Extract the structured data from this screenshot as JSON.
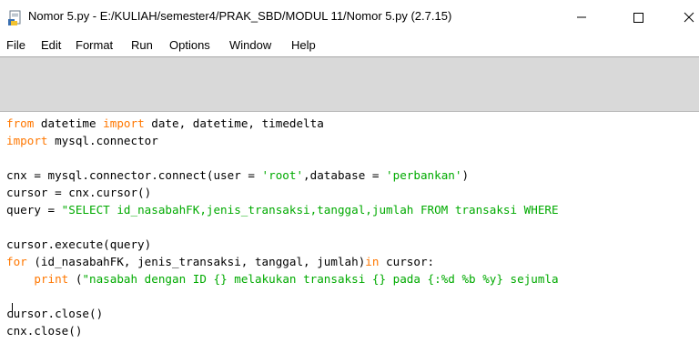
{
  "window": {
    "title": "Nomor 5.py - E:/KULIAH/semester4/PRAK_SBD/MODUL 11/Nomor 5.py (2.7.15)",
    "icon": "python-idle-icon"
  },
  "menu": {
    "items": [
      "File",
      "Edit",
      "Format",
      "Run",
      "Options",
      "Window",
      "Help"
    ]
  },
  "editor": {
    "lines": [
      [
        {
          "t": "from",
          "c": "kw"
        },
        {
          "t": " datetime ",
          "c": "n"
        },
        {
          "t": "import",
          "c": "kw"
        },
        {
          "t": " date, datetime, timedelta",
          "c": "n"
        }
      ],
      [
        {
          "t": "import",
          "c": "kw"
        },
        {
          "t": " mysql.connector",
          "c": "n"
        }
      ],
      [],
      [
        {
          "t": "cnx = mysql.connector.connect(user = ",
          "c": "n"
        },
        {
          "t": "'root'",
          "c": "str"
        },
        {
          "t": ",database = ",
          "c": "n"
        },
        {
          "t": "'perbankan'",
          "c": "str"
        },
        {
          "t": ")",
          "c": "n"
        }
      ],
      [
        {
          "t": "cursor = cnx.cursor()",
          "c": "n"
        }
      ],
      [
        {
          "t": "query = ",
          "c": "n"
        },
        {
          "t": "\"SELECT id_nasabahFK,jenis_transaksi,tanggal,jumlah FROM transaksi WHERE",
          "c": "str"
        }
      ],
      [],
      [
        {
          "t": "cursor.execute(query)",
          "c": "n"
        }
      ],
      [
        {
          "t": "for",
          "c": "kw"
        },
        {
          "t": " (id_nasabahFK, jenis_transaksi, tanggal, jumlah)",
          "c": "n"
        },
        {
          "t": "in",
          "c": "kw"
        },
        {
          "t": " cursor:",
          "c": "n"
        }
      ],
      [
        {
          "t": "    ",
          "c": "n"
        },
        {
          "t": "print",
          "c": "kw"
        },
        {
          "t": " (",
          "c": "n"
        },
        {
          "t": "\"nasabah dengan ID {} melakukan transaksi {} pada {:%d %b %y} sejumla",
          "c": "str"
        }
      ],
      [],
      [
        {
          "t": "cursor.close()",
          "c": "n"
        }
      ],
      [
        {
          "t": "cnx.close()",
          "c": "n"
        }
      ]
    ]
  },
  "colors": {
    "keyword": "#ff7700",
    "string": "#00aa00",
    "toolbar_gray": "#d9d9d9"
  }
}
